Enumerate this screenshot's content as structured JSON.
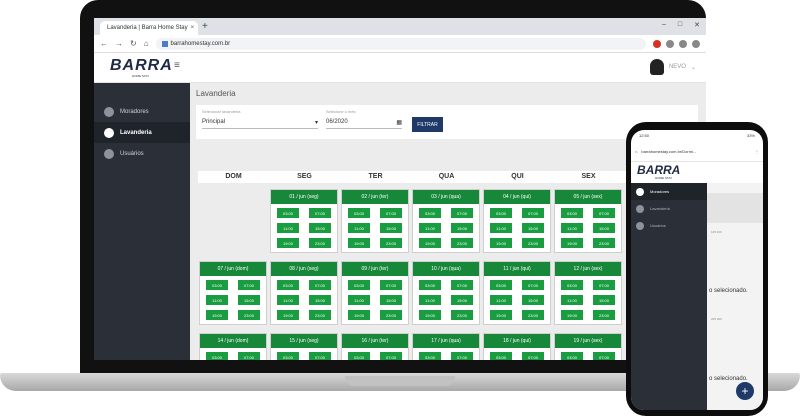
{
  "browser": {
    "tab_title": "Lavanderia | Barra Home Stay",
    "tab_close": "×",
    "new_tab": "+",
    "window_controls": [
      "–",
      "□",
      "✕"
    ],
    "nav_icons": [
      "←",
      "→",
      "↻",
      "⌂"
    ],
    "url": "barrahomestay.com.br"
  },
  "app": {
    "logo": "BARRA",
    "logo_sub": "HOME STAY",
    "menu_icon": "≡",
    "user_name": "NEVO",
    "user_caret": "⌄"
  },
  "sidebar": {
    "items": [
      {
        "label": "Moradores",
        "icon": "users-icon"
      },
      {
        "label": "Lavanderia",
        "icon": "laundry-icon",
        "active": true
      },
      {
        "label": "Usuários",
        "icon": "user-icon"
      }
    ]
  },
  "page": {
    "title": "Lavanderia",
    "filter": {
      "laundry_label": "Selecionar lavanderia",
      "laundry_value": "Principal",
      "month_label": "Selecione o mês",
      "month_value": "06/2020",
      "button": "FILTRAR"
    }
  },
  "calendar": {
    "weekdays": [
      "DOM",
      "SEG",
      "TER",
      "QUA",
      "QUI",
      "SEX"
    ],
    "slot_times": [
      "03:00",
      "07:00",
      "11:00",
      "15:00",
      "19:00",
      "23:00"
    ],
    "rows": [
      {
        "start_col": 1,
        "days": [
          "01 / jun (seg)",
          "02 / jun (ter)",
          "03 / jun (qua)",
          "04 / jun (qui)",
          "05 / jun (sex)"
        ]
      },
      {
        "start_col": 0,
        "days": [
          "07 / jun (dom)",
          "08 / jun (seg)",
          "09 / jun (ter)",
          "10 / jun (qua)",
          "11 / jun (qui)",
          "12 / jun (sex)"
        ]
      },
      {
        "start_col": 0,
        "days": [
          "14 / jun (dom)",
          "15 / jun (seg)",
          "16 / jun (ter)",
          "17 / jun (qua)",
          "18 / jun (qui)",
          "19 / jun (sex)"
        ]
      }
    ]
  },
  "phone": {
    "time": "12:50",
    "battery": "33%",
    "url": "barrahomestay.com.br/Dormi...",
    "logo": "BARRA",
    "logo_sub": "HOME STAY",
    "nav": [
      {
        "label": "Moradores",
        "active": true
      },
      {
        "label": "Lavanderia"
      },
      {
        "label": "Usuários"
      }
    ],
    "text_a": "105   106",
    "text_b": "o selecionado.",
    "text_c": "205   206",
    "text_d": "o selecionado.",
    "fab": "+"
  }
}
